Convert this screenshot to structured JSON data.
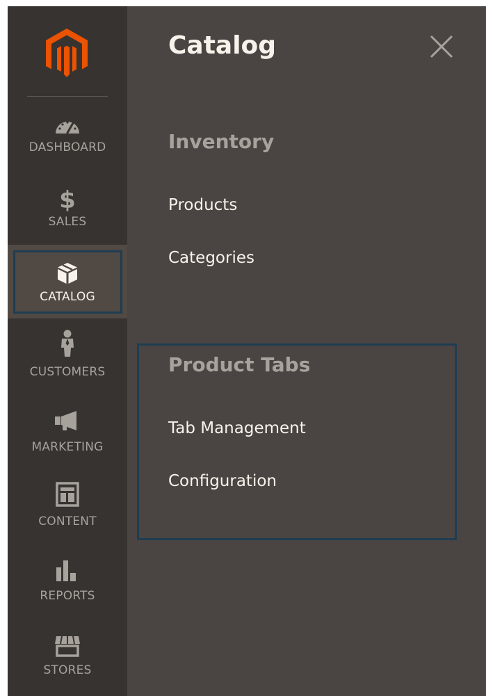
{
  "sidebar": {
    "items": [
      {
        "key": "dashboard",
        "label": "DASHBOARD",
        "icon": "speedometer-icon"
      },
      {
        "key": "sales",
        "label": "SALES",
        "icon": "dollar-icon"
      },
      {
        "key": "catalog",
        "label": "CATALOG",
        "icon": "box-icon",
        "active": true
      },
      {
        "key": "customers",
        "label": "CUSTOMERS",
        "icon": "person-icon"
      },
      {
        "key": "marketing",
        "label": "MARKETING",
        "icon": "megaphone-icon"
      },
      {
        "key": "content",
        "label": "CONTENT",
        "icon": "layout-icon"
      },
      {
        "key": "reports",
        "label": "REPORTS",
        "icon": "bar-chart-icon"
      },
      {
        "key": "stores",
        "label": "STORES",
        "icon": "storefront-icon"
      }
    ]
  },
  "panel": {
    "title": "Catalog",
    "close_icon": "close-icon",
    "sections": [
      {
        "title": "Inventory",
        "links": [
          "Products",
          "Categories"
        ]
      },
      {
        "title": "Product Tabs",
        "links": [
          "Tab Management",
          "Configuration"
        ]
      }
    ]
  },
  "colors": {
    "sidebar_bg": "#373330",
    "panel_bg": "#4a4542",
    "active_bg": "#514943",
    "brand_orange": "#eb5202",
    "highlight_outline": "#1f3d52",
    "text_light": "#f7f3eb",
    "text_muted": "#a8a29d"
  }
}
